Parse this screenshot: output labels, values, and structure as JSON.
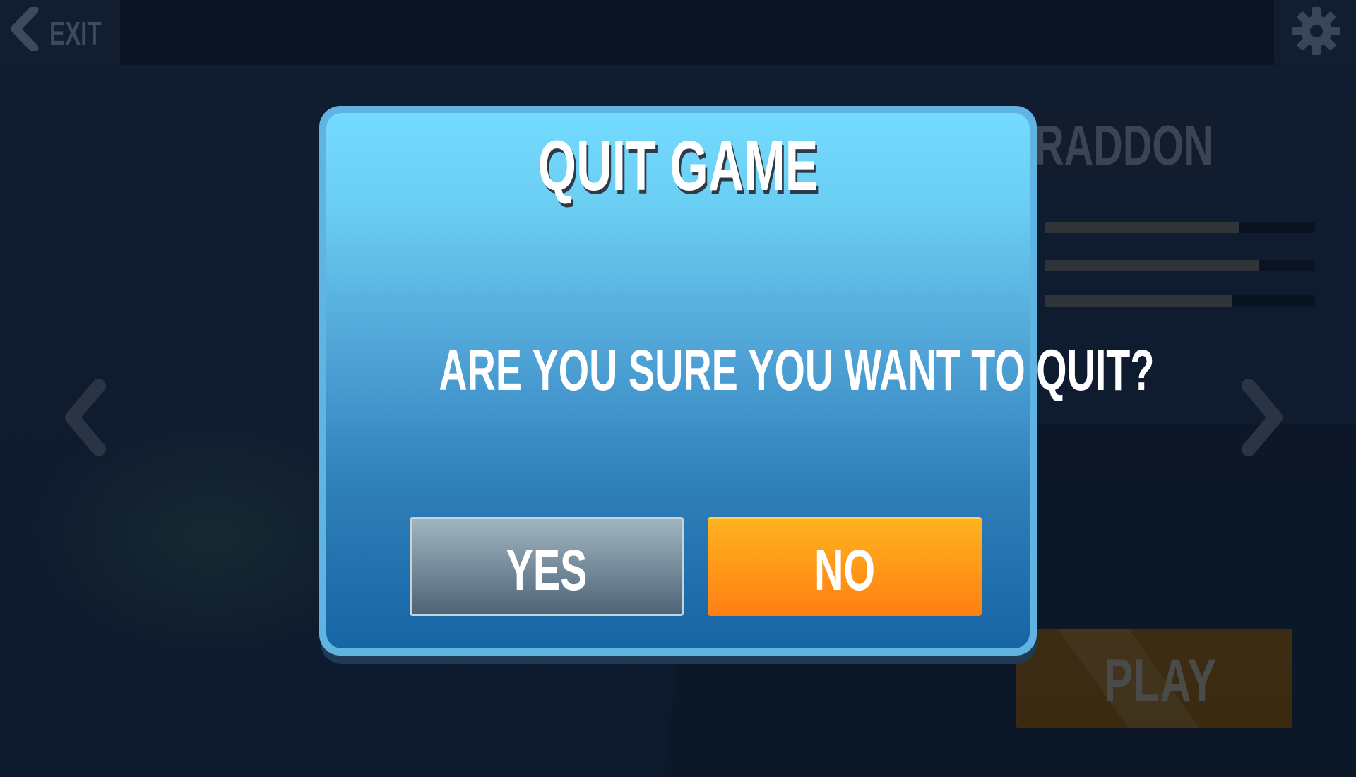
{
  "top_bar": {
    "exit_label": "EXIT",
    "exit_icon": "chevron-left-icon",
    "settings_icon": "gear-icon"
  },
  "hero": {
    "name": "RADDON",
    "stats": [
      0.72,
      0.79,
      0.69
    ]
  },
  "navigation": {
    "prev_icon": "chevron-left-icon",
    "next_icon": "chevron-right-icon"
  },
  "play_button": {
    "label": "PLAY"
  },
  "dialog": {
    "title": "QUIT GAME",
    "message": "ARE YOU SURE YOU WANT TO QUIT?",
    "yes_label": "YES",
    "no_label": "NO"
  },
  "colors": {
    "dialog_top": "#74dbfe",
    "dialog_bottom": "#1765a4",
    "no_button": "#ff9418",
    "yes_button": "#7b919f",
    "background": "#0e1a2e"
  }
}
